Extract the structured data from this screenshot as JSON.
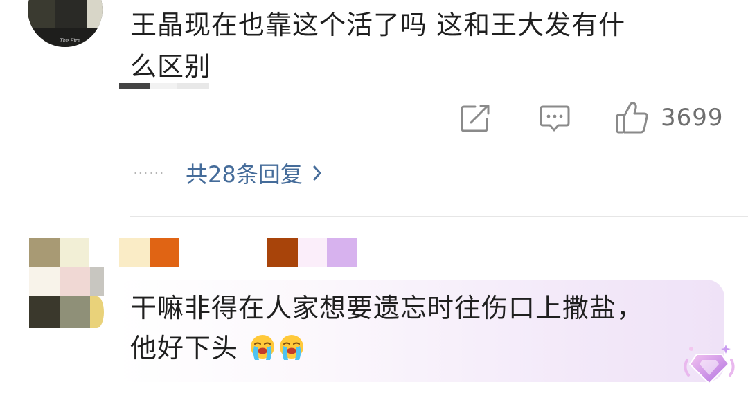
{
  "comments": [
    {
      "text_line1": "王晶现在也靠这个活了吗 这和王大发有什",
      "text_line2": "么区别",
      "actions": {
        "share_icon": "share-square-icon",
        "comment_icon": "comment-bubble-icon",
        "like_icon": "thumbs-up-icon",
        "like_count": "3699"
      },
      "replies": {
        "dots": "⋯⋯",
        "label": "共28条回复",
        "chevron": "›"
      }
    },
    {
      "text_line1": "干嘛非得在人家想要遗忘时往伤口上撒盐，",
      "text_line2": "他好下头",
      "emoji_icon": "crying-laughing-face-icon",
      "badge_icon": "gem-badge-icon"
    }
  ],
  "colors": {
    "reply_link": "#456c9a",
    "action_icon": "#8a8a8a",
    "bubble_accent": "#efe2f7"
  }
}
